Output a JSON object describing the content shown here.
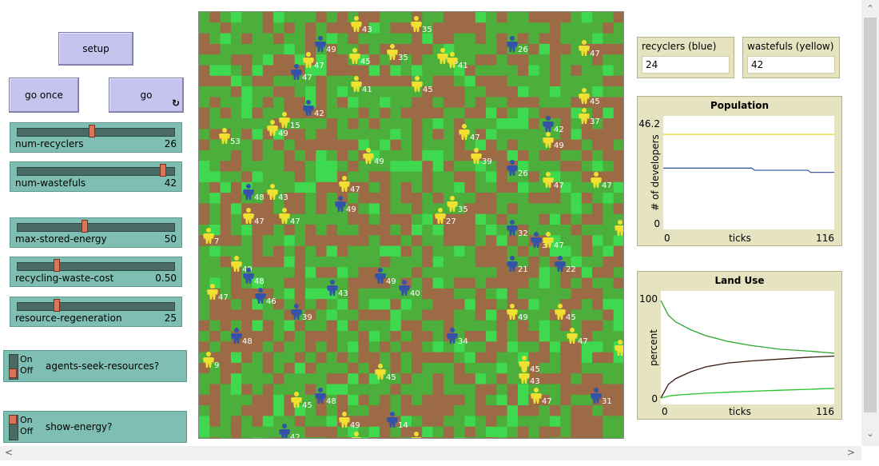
{
  "buttons": {
    "setup": "setup",
    "go_once": "go once",
    "go": "go"
  },
  "sliders": [
    {
      "label": "num-recyclers",
      "value": "26",
      "fraction": 0.47
    },
    {
      "label": "num-wastefuls",
      "value": "42",
      "fraction": 0.93
    },
    {
      "label": "max-stored-energy",
      "value": "50",
      "fraction": 0.42
    },
    {
      "label": "recycling-waste-cost",
      "value": "0.50",
      "fraction": 0.24
    },
    {
      "label": "resource-regeneration",
      "value": "25",
      "fraction": 0.24
    }
  ],
  "switches": [
    {
      "label": "agents-seek-resources?",
      "on": "On",
      "off": "Off",
      "state": "off"
    },
    {
      "label": "show-energy?",
      "on": "On",
      "off": "Off",
      "state": "on"
    }
  ],
  "monitors": [
    {
      "label": "recyclers (blue)",
      "value": "24"
    },
    {
      "label": "wastefuls (yellow)",
      "value": "42"
    }
  ],
  "plots": {
    "population": {
      "title": "Population",
      "ylabel": "# of developers",
      "xlabel": "ticks",
      "ymax": "46.2",
      "ymin": "0",
      "xmin": "0",
      "xmax": "116"
    },
    "land_use": {
      "title": "Land Use",
      "ylabel": "percent",
      "xlabel": "ticks",
      "ymax": "100",
      "ymin": "0",
      "xmin": "0",
      "xmax": "116"
    }
  },
  "chart_data": [
    {
      "type": "line",
      "title": "Population",
      "xlabel": "ticks",
      "ylabel": "# of developers",
      "xlim": [
        0,
        116
      ],
      "ylim": [
        0,
        46.2
      ],
      "series": [
        {
          "color": "#e6d820",
          "x": [
            0,
            116
          ],
          "y": [
            42,
            42
          ]
        },
        {
          "color": "#3a5fa8",
          "x": [
            0,
            60,
            62,
            98,
            100,
            116
          ],
          "y": [
            26,
            26,
            25,
            25,
            24,
            24
          ]
        }
      ]
    },
    {
      "type": "line",
      "title": "Land Use",
      "xlabel": "ticks",
      "ylabel": "percent",
      "xlim": [
        0,
        116
      ],
      "ylim": [
        0,
        100
      ],
      "series": [
        {
          "color": "#2da82d",
          "x": [
            0,
            5,
            10,
            20,
            30,
            45,
            60,
            80,
            100,
            116
          ],
          "y": [
            100,
            85,
            78,
            70,
            64,
            58,
            54,
            50,
            48,
            46
          ]
        },
        {
          "color": "#3b1a12",
          "x": [
            0,
            5,
            10,
            20,
            30,
            45,
            60,
            80,
            100,
            116
          ],
          "y": [
            0,
            14,
            20,
            27,
            32,
            36,
            38,
            40,
            42,
            43
          ]
        },
        {
          "color": "#2ac42a",
          "x": [
            0,
            5,
            10,
            20,
            30,
            45,
            60,
            80,
            100,
            116
          ],
          "y": [
            0,
            2,
            3,
            4,
            5,
            6,
            7,
            8,
            9,
            10
          ]
        }
      ]
    }
  ],
  "colors": {
    "patch_brown": "#9c6a45",
    "patch_green": "#4caf3c",
    "patch_light": "#3fd94f",
    "wasteful": "#f0e030",
    "recycler": "#3452a8"
  },
  "agents": [
    {
      "kind": "w",
      "energy": "43"
    },
    {
      "kind": "w",
      "energy": "35"
    },
    {
      "kind": "b",
      "energy": "49"
    },
    {
      "kind": "w",
      "energy": "47"
    },
    {
      "kind": "w",
      "energy": "45"
    },
    {
      "kind": "w",
      "energy": "35"
    },
    {
      "kind": "w",
      "energy": "35"
    },
    {
      "kind": "w",
      "energy": "41"
    },
    {
      "kind": "b",
      "energy": "26"
    },
    {
      "kind": "w",
      "energy": "47"
    },
    {
      "kind": "b",
      "energy": "47"
    },
    {
      "kind": "w",
      "energy": "41"
    },
    {
      "kind": "w",
      "energy": "45"
    },
    {
      "kind": "w",
      "energy": "45"
    },
    {
      "kind": "b",
      "energy": "42"
    },
    {
      "kind": "w",
      "energy": "15"
    },
    {
      "kind": "w",
      "energy": "49"
    },
    {
      "kind": "w",
      "energy": "53"
    },
    {
      "kind": "w",
      "energy": "47"
    },
    {
      "kind": "b",
      "energy": "42"
    },
    {
      "kind": "w",
      "energy": "37"
    },
    {
      "kind": "w",
      "energy": "49"
    },
    {
      "kind": "w",
      "energy": "49"
    },
    {
      "kind": "w",
      "energy": "39"
    },
    {
      "kind": "b",
      "energy": "26"
    },
    {
      "kind": "w",
      "energy": "47"
    },
    {
      "kind": "w",
      "energy": "47"
    },
    {
      "kind": "w",
      "energy": "47"
    },
    {
      "kind": "b",
      "energy": "49"
    },
    {
      "kind": "b",
      "energy": "48"
    },
    {
      "kind": "w",
      "energy": "43"
    },
    {
      "kind": "w",
      "energy": "47"
    },
    {
      "kind": "w",
      "energy": "47"
    },
    {
      "kind": "w",
      "energy": "35"
    },
    {
      "kind": "w",
      "energy": "27"
    },
    {
      "kind": "b",
      "energy": "32"
    },
    {
      "kind": "b",
      "energy": "3"
    },
    {
      "kind": "w",
      "energy": "47"
    },
    {
      "kind": "w",
      "energy": "4"
    },
    {
      "kind": "w",
      "energy": "7"
    },
    {
      "kind": "w",
      "energy": "49"
    },
    {
      "kind": "b",
      "energy": "21"
    },
    {
      "kind": "b",
      "energy": "22"
    },
    {
      "kind": "w",
      "energy": "47"
    },
    {
      "kind": "b",
      "energy": "48"
    },
    {
      "kind": "b",
      "energy": "46"
    },
    {
      "kind": "b",
      "energy": "43"
    },
    {
      "kind": "b",
      "energy": "49"
    },
    {
      "kind": "b",
      "energy": "40"
    },
    {
      "kind": "b",
      "energy": "39"
    },
    {
      "kind": "w",
      "energy": "49"
    },
    {
      "kind": "w",
      "energy": "45"
    },
    {
      "kind": "b",
      "energy": "48"
    },
    {
      "kind": "b",
      "energy": "34"
    },
    {
      "kind": "w",
      "energy": "47"
    },
    {
      "kind": "w",
      "energy": "4"
    },
    {
      "kind": "w",
      "energy": "9"
    },
    {
      "kind": "w",
      "energy": "45"
    },
    {
      "kind": "w",
      "energy": "43"
    },
    {
      "kind": "w",
      "energy": "45"
    },
    {
      "kind": "w",
      "energy": "47"
    },
    {
      "kind": "b",
      "energy": "48"
    },
    {
      "kind": "w",
      "energy": "45"
    },
    {
      "kind": "b",
      "energy": "31"
    },
    {
      "kind": "w",
      "energy": "49"
    },
    {
      "kind": "b",
      "energy": "14"
    },
    {
      "kind": "b",
      "energy": "42"
    },
    {
      "kind": "w",
      "energy": "43"
    },
    {
      "kind": "w",
      "energy": "35"
    }
  ]
}
